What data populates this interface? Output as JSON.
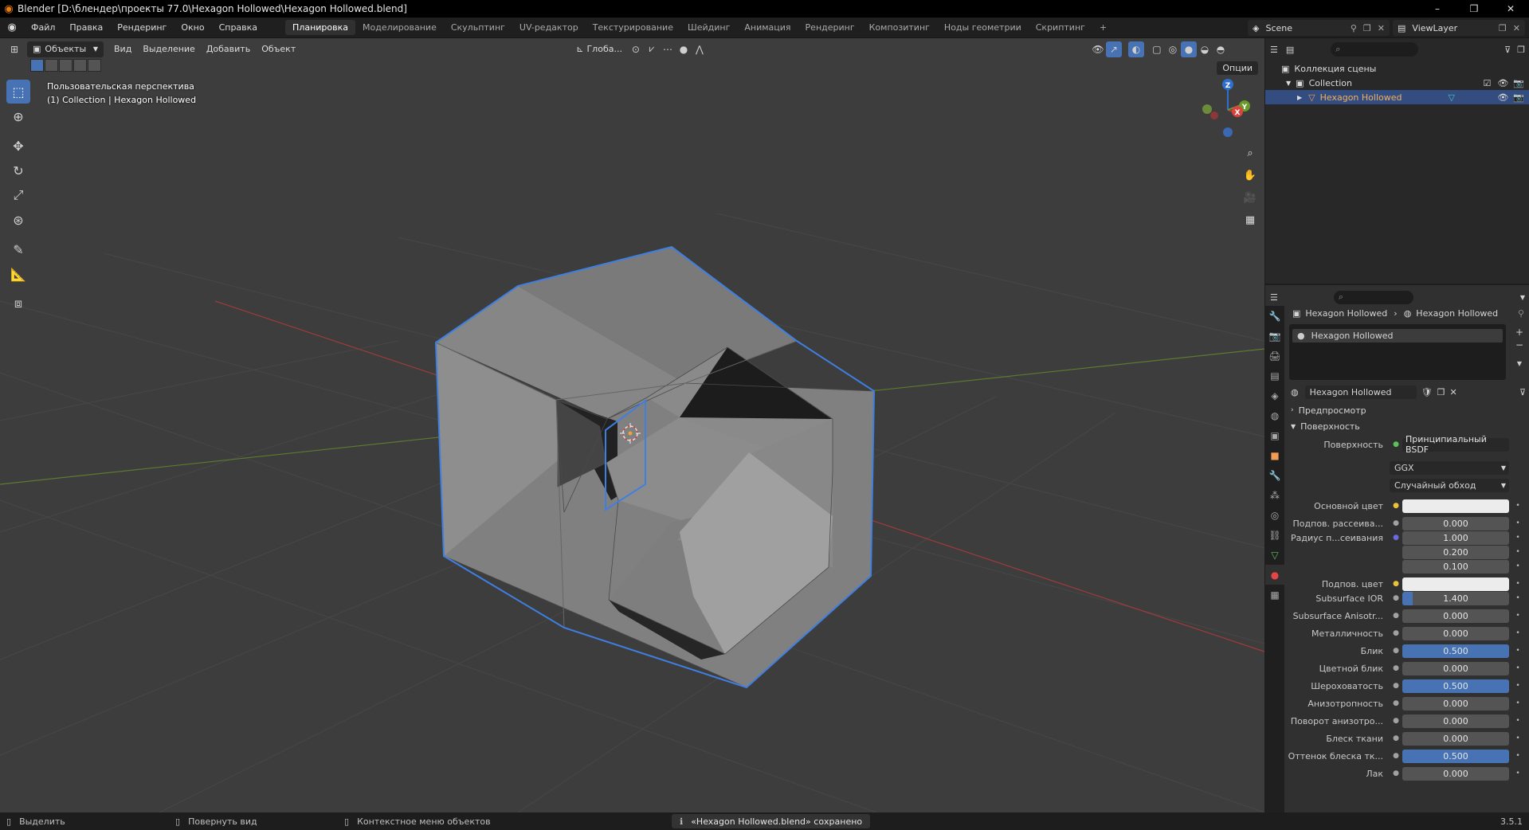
{
  "window": {
    "title": "Blender [D:\\блендер\\проекты 77.0\\Hexagon Hollowed\\Hexagon Hollowed.blend]",
    "minimize": "–",
    "maximize": "❐",
    "close": "✕"
  },
  "menu": [
    "Файл",
    "Правка",
    "Рендеринг",
    "Окно",
    "Справка"
  ],
  "workspaces": [
    "Планировка",
    "Моделирование",
    "Скульптинг",
    "UV-редактор",
    "Текстурирование",
    "Шейдинг",
    "Анимация",
    "Рендеринг",
    "Композитинг",
    "Ноды геометрии",
    "Скриптинг"
  ],
  "workspace_add": "+",
  "scene": {
    "name": "Scene",
    "viewlayer": "ViewLayer"
  },
  "viewport": {
    "mode": "Объекты",
    "menus": [
      "Вид",
      "Выделение",
      "Добавить",
      "Объект"
    ],
    "orientation": "Глоба...",
    "options": "Опции",
    "overlay_line1": "Пользовательская перспектива",
    "overlay_line2": "(1) Collection | Hexagon Hollowed",
    "gizmo": {
      "x": "X",
      "y": "Y",
      "z": "Z"
    }
  },
  "outliner": {
    "scene_collection": "Коллекция сцены",
    "collection": "Collection",
    "object": "Hexagon Hollowed"
  },
  "properties": {
    "breadcrumb_object": "Hexagon Hollowed",
    "breadcrumb_material": "Hexagon Hollowed",
    "slot": "Hexagon Hollowed",
    "material_name": "Hexagon Hollowed",
    "panel_preview": "Предпросмотр",
    "panel_surface": "Поверхность",
    "surface_label": "Поверхность",
    "surface_value": "Принципиальный BSDF",
    "distribution": "GGX",
    "subsurface_method": "Случайный обход",
    "rows": [
      {
        "label": "Основной цвет",
        "type": "color",
        "value": ""
      },
      {
        "label": "Подпов. рассеива...",
        "type": "num",
        "value": "0.000",
        "fill": 0
      },
      {
        "label": "Радиус п...сеивания",
        "type": "num",
        "value": "1.000",
        "fill": 0
      },
      {
        "label": "",
        "type": "num",
        "value": "0.200",
        "fill": 0
      },
      {
        "label": "",
        "type": "num",
        "value": "0.100",
        "fill": 0
      },
      {
        "label": "Подпов. цвет",
        "type": "color",
        "value": ""
      },
      {
        "label": "Subsurface IOR",
        "type": "num",
        "value": "1.400",
        "fill": 0.1
      },
      {
        "label": "Subsurface Anisotr...",
        "type": "num",
        "value": "0.000",
        "fill": 0
      },
      {
        "label": "Металличность",
        "type": "num",
        "value": "0.000",
        "fill": 0
      },
      {
        "label": "Блик",
        "type": "num",
        "value": "0.500",
        "fill": 1
      },
      {
        "label": "Цветной блик",
        "type": "num",
        "value": "0.000",
        "fill": 0
      },
      {
        "label": "Шероховатость",
        "type": "num",
        "value": "0.500",
        "fill": 1
      },
      {
        "label": "Анизотропность",
        "type": "num",
        "value": "0.000",
        "fill": 0
      },
      {
        "label": "Поворот анизотро...",
        "type": "num",
        "value": "0.000",
        "fill": 0
      },
      {
        "label": "Блеск ткани",
        "type": "num",
        "value": "0.000",
        "fill": 0
      },
      {
        "label": "Оттенок блеска тк...",
        "type": "num",
        "value": "0.500",
        "fill": 1
      },
      {
        "label": "Лак",
        "type": "num",
        "value": "0.000",
        "fill": 0
      }
    ]
  },
  "statusbar": {
    "select": "Выделить",
    "rotate": "Повернуть вид",
    "context": "Контекстное меню объектов",
    "message": "«Hexagon Hollowed.blend» сохранено",
    "version": "3.5.1"
  }
}
